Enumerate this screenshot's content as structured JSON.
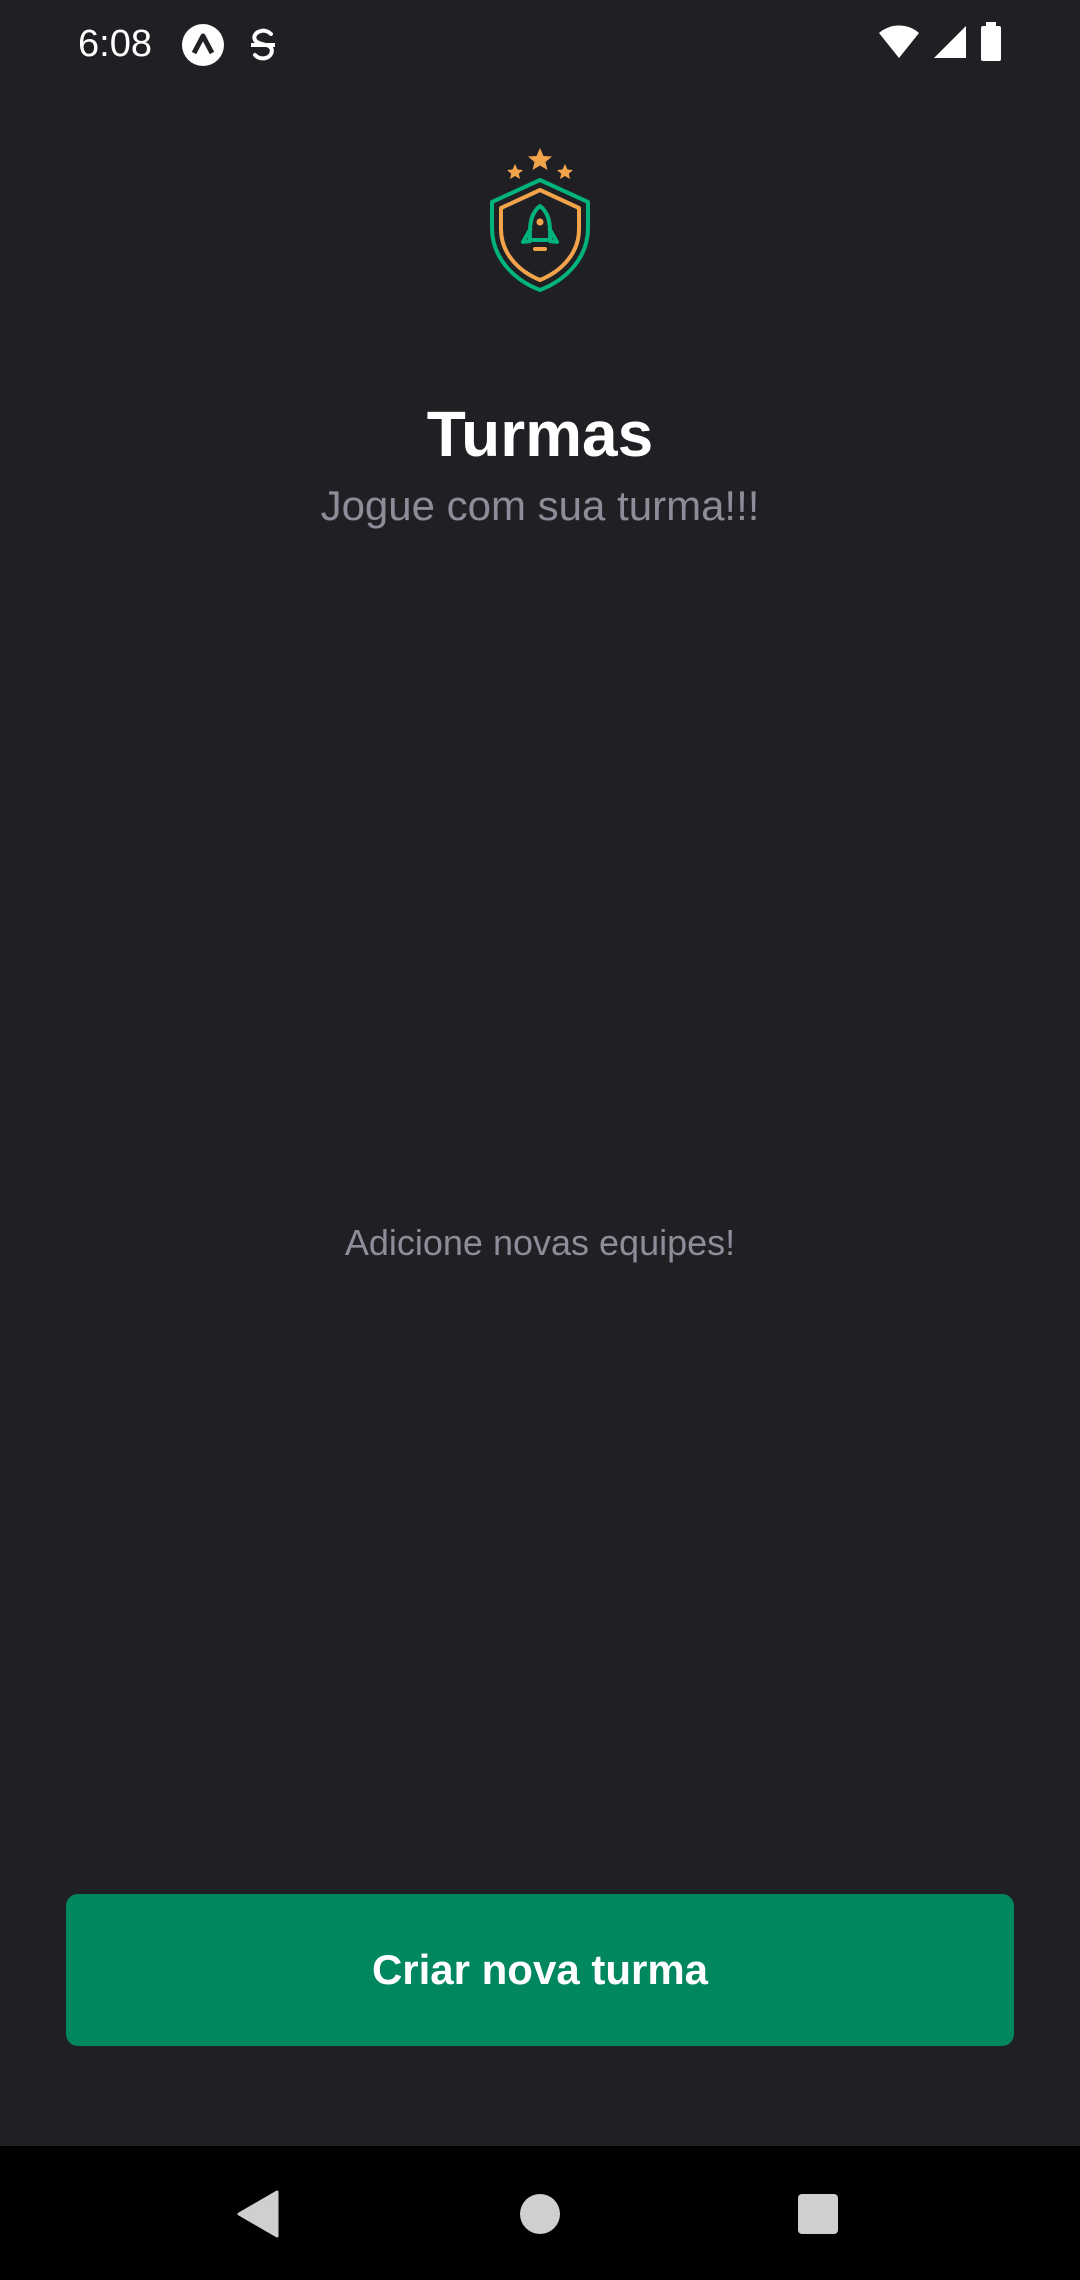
{
  "status_bar": {
    "time": "6:08",
    "icons": [
      "expo-go-icon",
      "sync-icon",
      "wifi-icon",
      "cellular-signal-icon",
      "battery-icon"
    ]
  },
  "header": {
    "logo_icon": "shield-rocket-logo-icon",
    "title": "Turmas",
    "subtitle": "Jogue com sua turma!!!"
  },
  "main": {
    "empty_message": "Adicione novas equipes!"
  },
  "actions": {
    "create_button_label": "Criar nova turma"
  },
  "nav_bar": {
    "icons": [
      "back-icon",
      "home-icon",
      "recents-icon"
    ]
  },
  "colors": {
    "background": "#202024",
    "primary_green": "#00875F",
    "logo_green": "#00B37E",
    "logo_orange": "#F2A44B",
    "subtitle_gray": "#8D8D99"
  }
}
